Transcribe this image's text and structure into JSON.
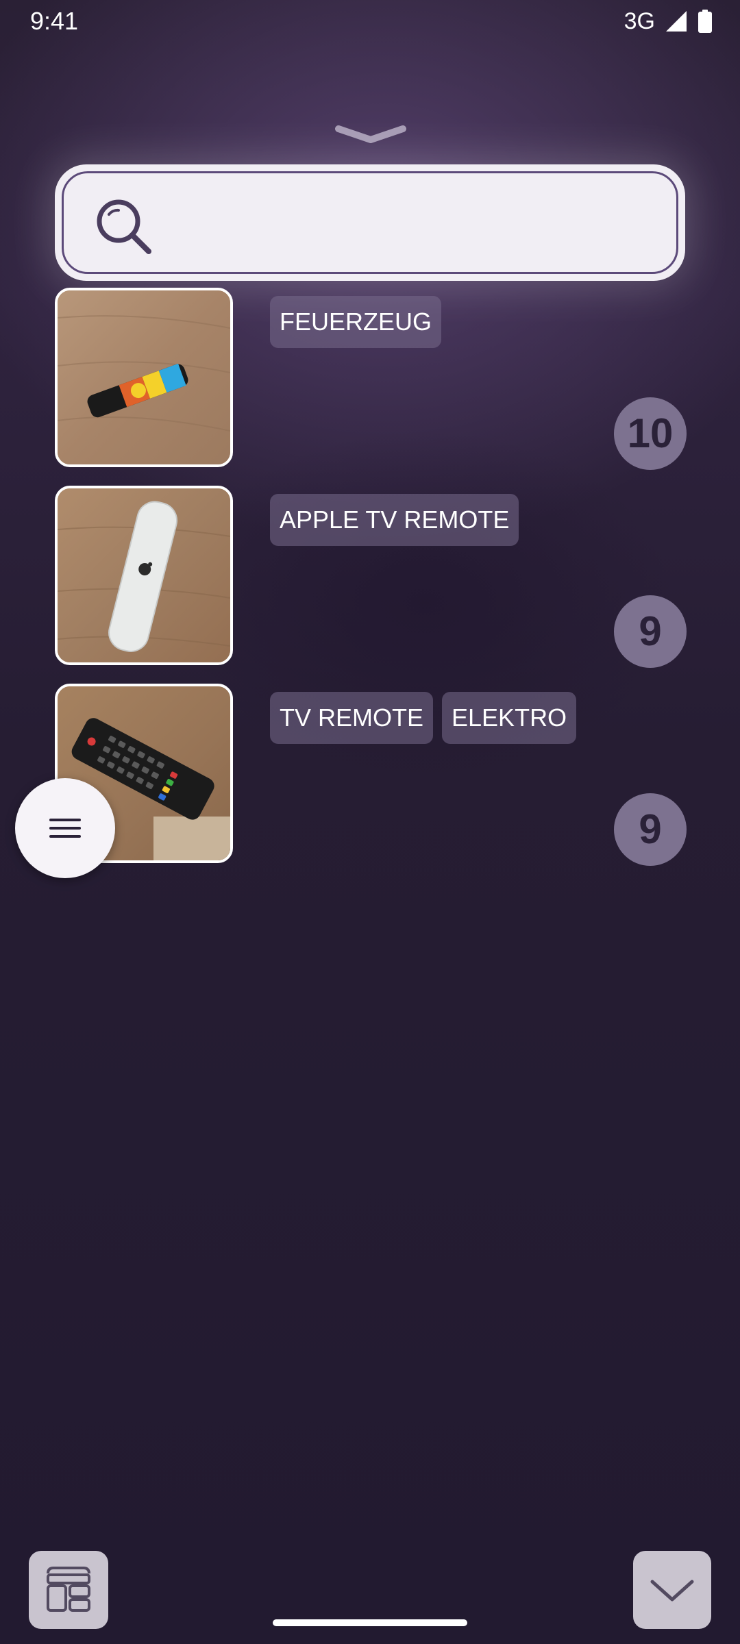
{
  "status_bar": {
    "time": "9:41",
    "network": "3G",
    "icons": [
      "signal-icon",
      "battery-icon"
    ]
  },
  "handle": {
    "icon": "chevron-down-icon"
  },
  "search": {
    "value": "",
    "placeholder": "",
    "icon": "search-icon"
  },
  "items": [
    {
      "tags": [
        "FEUERZEUG"
      ],
      "count": "10",
      "image": "lighter-photo"
    },
    {
      "tags": [
        "APPLE TV REMOTE"
      ],
      "count": "9",
      "image": "apple-tv-remote-photo"
    },
    {
      "tags": [
        "TV REMOTE",
        "ELEKTRO"
      ],
      "count": "9",
      "image": "tv-remote-photo"
    }
  ],
  "fab": {
    "icon": "menu-icon"
  },
  "bottom_bar": {
    "left_icon": "layout-grid-icon",
    "right_icon": "chevron-down-icon"
  },
  "colors": {
    "background": "#221a30",
    "search_surface": "#f1eef4",
    "search_border": "#5c4a7a",
    "tag_bg": "#786c8c",
    "badge_bg": "#7d7290",
    "badge_text": "#2a2138",
    "button_bg": "#c9c4cf"
  }
}
